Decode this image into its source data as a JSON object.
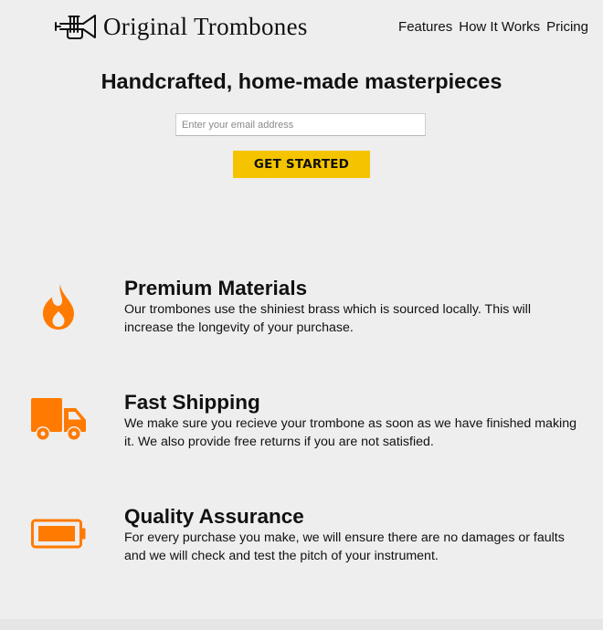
{
  "header": {
    "brand": "Original Trombones",
    "logo_icon": "trumpet-icon",
    "nav": [
      {
        "label": "Features"
      },
      {
        "label": "How It Works"
      },
      {
        "label": "Pricing"
      }
    ]
  },
  "hero": {
    "title": "Handcrafted, home-made masterpieces",
    "email_placeholder": "Enter your email address",
    "button_label": "GET STARTED"
  },
  "features": [
    {
      "icon": "fire-icon",
      "title": "Premium Materials",
      "description": "Our trombones use the shiniest brass which is sourced locally. This will increase the longevity of your purchase."
    },
    {
      "icon": "truck-icon",
      "title": "Fast Shipping",
      "description": "We make sure you recieve your trombone as soon as we have finished making it. We also provide free returns if you are not satisfied."
    },
    {
      "icon": "battery-icon",
      "title": "Quality Assurance",
      "description": "For every purchase you make, we will ensure there are no damages or faults and we will check and test the pitch of your instrument."
    }
  ],
  "colors": {
    "background": "#eeeeee",
    "accent_orange": "#ff7a00",
    "button_yellow": "#f5c400",
    "text": "#111111"
  }
}
